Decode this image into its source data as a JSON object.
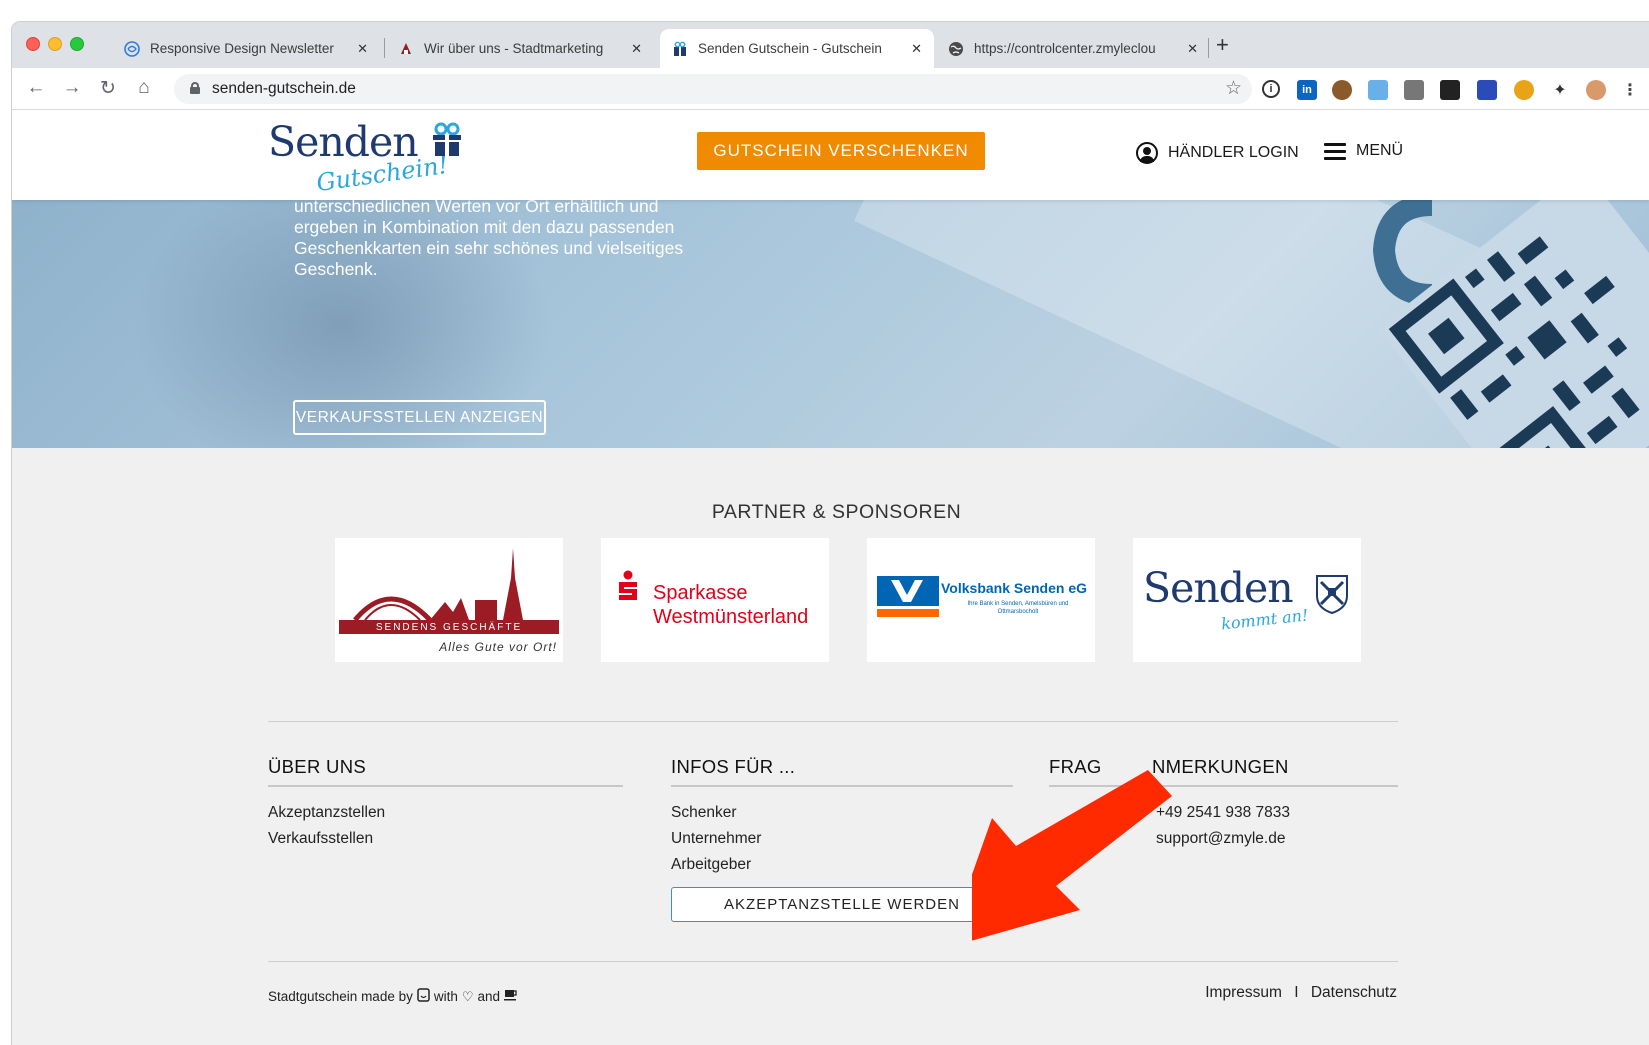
{
  "browser": {
    "tabs": [
      {
        "title": "Responsive Design Newsletter",
        "favicon": "design-swirl-icon",
        "close": "✕"
      },
      {
        "title": "Wir über uns - Stadtmarketing",
        "favicon": "stadtmarketing-icon",
        "close": "✕"
      },
      {
        "title": "Senden Gutschein - Gutschein",
        "favicon": "gift-icon",
        "close": "✕"
      },
      {
        "title": "https://controlcenter.zmyleclou",
        "favicon": "globe-icon",
        "close": "✕"
      }
    ],
    "new_tab": "+",
    "url": "senden-gutschein.de"
  },
  "header": {
    "logo_word": "Senden",
    "logo_script": "Gutschein!",
    "cta_label": "GUTSCHEIN VERSCHENKEN",
    "login_label": "HÄNDLER LOGIN",
    "menu_label": "MENÜ"
  },
  "hero": {
    "text": "unterschiedlichen Werten vor Ort erhältlich und ergeben in Kombination mit den dazu passenden Geschenkkarten ein sehr schönes und vielseitiges Geschenk.",
    "button_label": "VERKAUFSSTELLEN ANZEIGEN"
  },
  "partners": {
    "title": "PARTNER & SPONSOREN",
    "sendens_geschaefte": {
      "banner": "SENDENS GESCHÄFTE",
      "tagline": "Alles Gute vor Ort!"
    },
    "sparkasse": {
      "line1": "Sparkasse",
      "line2": "Westmünsterland"
    },
    "volksbank": {
      "name": "Volksbank Senden eG",
      "tagline": "Ihre Bank in Senden, Amelsbüren und Ottmarsbocholt"
    },
    "senden_kommt_an": {
      "word": "Senden",
      "script": "kommt an!"
    }
  },
  "footer": {
    "about": {
      "title": "ÜBER UNS",
      "links": [
        "Akzeptanzstellen",
        "Verkaufsstellen"
      ]
    },
    "info": {
      "title": "INFOS FÜR ...",
      "links": [
        "Schenker",
        "Unternehmer",
        "Arbeitgeber"
      ]
    },
    "contact": {
      "title_left": "FRAG",
      "title_right": "NMERKUNGEN",
      "phone": "+49 2541 938 7833",
      "email": "support@zmyle.de"
    },
    "accept_button": "AKZEPTANZSTELLE WERDEN",
    "made_by": "Stadtgutschein made by",
    "with": "with",
    "and": "and",
    "impressum": "Impressum",
    "separator": "I",
    "datenschutz": "Datenschutz"
  },
  "colors": {
    "accent_orange": "#f08a00",
    "brand_blue": "#1e3a6e",
    "arrow_red": "#ff2a00"
  }
}
